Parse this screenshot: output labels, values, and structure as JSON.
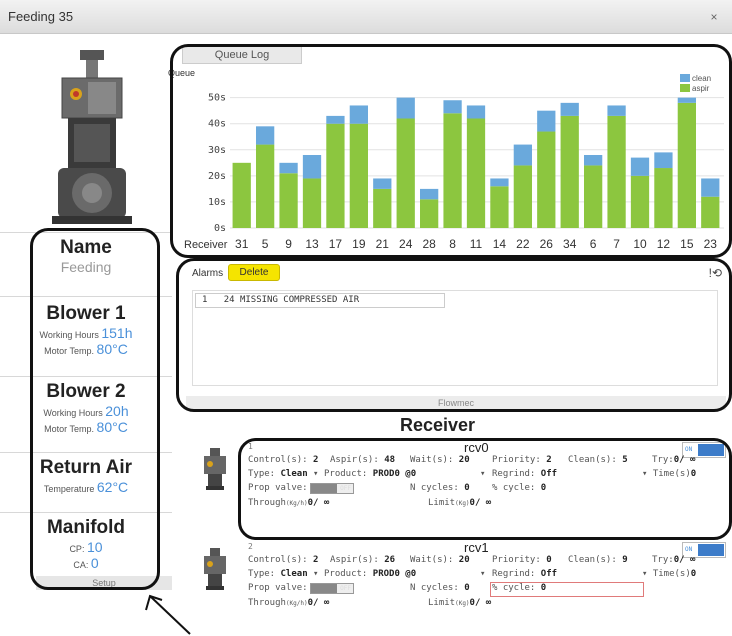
{
  "window": {
    "title": "Feeding 35",
    "close": "×"
  },
  "left": {
    "name_h": "Name",
    "name_v": "Feeding",
    "b1_h": "Blower 1",
    "b1_wh_l": "Working Hours",
    "b1_wh_v": "151h",
    "b1_mt_l": "Motor Temp.",
    "b1_mt_v": "80°C",
    "b2_h": "Blower 2",
    "b2_wh_l": "Working Hours",
    "b2_wh_v": "20h",
    "b2_mt_l": "Motor Temp.",
    "b2_mt_v": "80°C",
    "ra_h": "Return Air",
    "ra_t_l": "Temperature",
    "ra_t_v": "62°C",
    "mf_h": "Manifold",
    "cp_l": "CP:",
    "cp_v": "10",
    "ca_l": "CA:",
    "ca_v": "0",
    "setup": "Setup"
  },
  "queue_tab": "Queue Log",
  "chart_data": {
    "type": "bar",
    "stacked": true,
    "ylabel": "Queue",
    "xlabel": "Receiver",
    "y_ticks": [
      "0s",
      "10s",
      "20s",
      "30s",
      "40s",
      "50s"
    ],
    "ylim": [
      0,
      56
    ],
    "categories": [
      "31",
      "5",
      "9",
      "13",
      "17",
      "19",
      "21",
      "24",
      "28",
      "8",
      "11",
      "14",
      "22",
      "26",
      "34",
      "6",
      "7",
      "10",
      "12",
      "15",
      "23"
    ],
    "series": [
      {
        "name": "aspir",
        "color": "#8cc63f",
        "values": [
          25,
          32,
          21,
          19,
          40,
          40,
          15,
          42,
          11,
          44,
          42,
          16,
          24,
          37,
          43,
          24,
          43,
          20,
          23,
          48,
          12
        ]
      },
      {
        "name": "clean",
        "color": "#6aa9dc",
        "values": [
          0,
          7,
          4,
          9,
          3,
          7,
          4,
          8,
          4,
          5,
          5,
          3,
          8,
          8,
          5,
          4,
          4,
          7,
          6,
          2,
          7
        ]
      }
    ],
    "legend_position": "top-right",
    "grid": true
  },
  "alarms": {
    "title": "Alarms",
    "delete": "Delete",
    "history_icon": "!⟲",
    "rows": [
      {
        "idx": "1",
        "text": "24 MISSING COMPRESSED AIR"
      }
    ],
    "footer": "Flowmec"
  },
  "receiver_title": "Receiver",
  "receivers": [
    {
      "num": "1",
      "name": "rcv0",
      "toggle": "ON",
      "control_l": "Control(s):",
      "control_v": "2",
      "aspir_l": "Aspir(s):",
      "aspir_v": "48",
      "wait_l": "Wait(s):",
      "wait_v": "20",
      "prio_l": "Priority:",
      "prio_v": "2",
      "clean_l": "Clean(s):",
      "clean_v": "5",
      "try_l": "Try:",
      "try_v": "0/ ∞",
      "type_l": "Type:",
      "type_v": "Clean",
      "prod_l": "Product:",
      "prod_v": "PROD0 @0",
      "regrind_l": "Regrind:",
      "regrind_v": "Off",
      "time_l": "Time(s)",
      "time_v": "0",
      "prop_l": "Prop valve:",
      "prop_sw": "OFF",
      "ncyc_l": "N cycles:",
      "ncyc_v": "0",
      "pcyc_l": "% cycle:",
      "pcyc_v": "0",
      "through_l": "Through",
      "through_u": "(Kg/h)",
      "through_v": "0/ ∞",
      "limit_l": "Limit",
      "limit_u": "(Kg)",
      "limit_v": "0/ ∞"
    },
    {
      "num": "2",
      "name": "rcv1",
      "toggle": "ON",
      "control_l": "Control(s):",
      "control_v": "2",
      "aspir_l": "Aspir(s):",
      "aspir_v": "26",
      "wait_l": "Wait(s):",
      "wait_v": "20",
      "prio_l": "Priority:",
      "prio_v": "0",
      "clean_l": "Clean(s):",
      "clean_v": "9",
      "try_l": "Try:",
      "try_v": "0/ ∞",
      "type_l": "Type:",
      "type_v": "Clean",
      "prod_l": "Product:",
      "prod_v": "PROD0 @0",
      "regrind_l": "Regrind:",
      "regrind_v": "Off",
      "time_l": "Time(s)",
      "time_v": "0",
      "prop_l": "Prop valve:",
      "prop_sw": "OFF",
      "ncyc_l": "N cycles:",
      "ncyc_v": "0",
      "pcyc_l": "% cycle:",
      "pcyc_v": "0",
      "through_l": "Through",
      "through_u": "(Kg/h)",
      "through_v": "0/ ∞",
      "limit_l": "Limit",
      "limit_u": "(Kg)",
      "limit_v": "0/ ∞"
    }
  ]
}
